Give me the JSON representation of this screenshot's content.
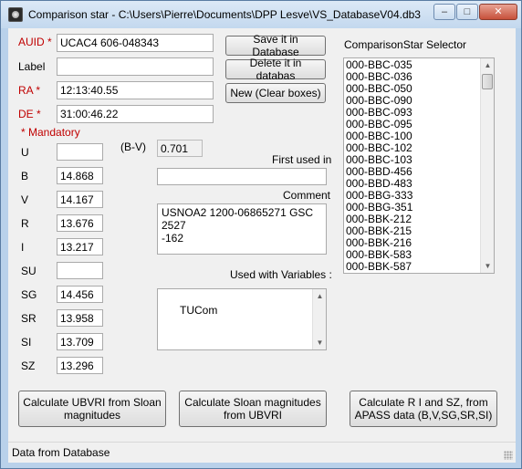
{
  "window": {
    "title": "Comparison star - C:\\Users\\Pierre\\Documents\\DPP Lesve\\VS_DatabaseV04.db3",
    "min_glyph": "–",
    "max_glyph": "□",
    "close_glyph": "✕"
  },
  "form": {
    "auid_label": "AUID",
    "auid_value": "UCAC4 606-048343",
    "label_label": "Label",
    "label_value": "",
    "ra_label": "RA",
    "ra_value": "12:13:40.55",
    "de_label": "DE",
    "de_value": "31:00:46.22",
    "required_mark": "*",
    "mandatory_note": "* Mandatory",
    "bv_label": "(B-V)",
    "bv_value": "0.701",
    "first_used_label": "First used in",
    "first_used_value": "",
    "comment_label": "Comment",
    "comment_value": "USNOA2 1200-06865271 GSC 2527\n-162",
    "used_with_label": "Used with Variables :",
    "used_with_value": "TUCom"
  },
  "magnitudes": [
    {
      "label": "U",
      "value": ""
    },
    {
      "label": "B",
      "value": "14.868"
    },
    {
      "label": "V",
      "value": "14.167"
    },
    {
      "label": "R",
      "value": "13.676"
    },
    {
      "label": "I",
      "value": "13.217"
    },
    {
      "label": "SU",
      "value": ""
    },
    {
      "label": "SG",
      "value": "14.456"
    },
    {
      "label": "SR",
      "value": "13.958"
    },
    {
      "label": "SI",
      "value": "13.709"
    },
    {
      "label": "SZ",
      "value": "13.296"
    }
  ],
  "buttons": {
    "save": "Save it in Database",
    "delete": "Delete it in databas",
    "new": "New (Clear boxes)",
    "calc_ubvri": "Calculate UBVRI from Sloan\nmagnitudes",
    "calc_sloan": "Calculate Sloan magnitudes\nfrom UBVRI",
    "calc_apass": "Calculate R  I and SZ, from\nAPASS data (B,V,SG,SR,SI)"
  },
  "selector": {
    "title": "ComparisonStar Selector",
    "items": [
      "000-BBC-035",
      "000-BBC-036",
      "000-BBC-050",
      "000-BBC-090",
      "000-BBC-093",
      "000-BBC-095",
      "000-BBC-100",
      "000-BBC-102",
      "000-BBC-103",
      "000-BBD-456",
      "000-BBD-483",
      "000-BBG-333",
      "000-BBG-351",
      "000-BBK-212",
      "000-BBK-215",
      "000-BBK-216",
      "000-BBK-583",
      "000-BBK-587"
    ],
    "scroll_up_glyph": "▲",
    "scroll_down_glyph": "▼"
  },
  "status": {
    "text": "Data from Database"
  },
  "colors": {
    "required_label": "#c00000",
    "window_frame": "#b9d1ea",
    "client_bg": "#f0f0f0"
  }
}
